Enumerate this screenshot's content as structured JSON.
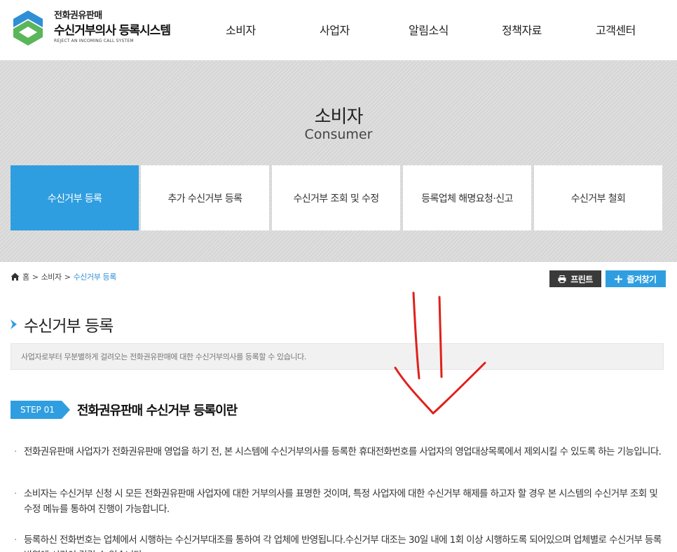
{
  "header": {
    "logo_line1": "전화권유판매",
    "logo_line2": "수신거부의사 등록시스템",
    "logo_line3": "REJECT AN INCOMING CALL SYSTEM",
    "nav": [
      "소비자",
      "사업자",
      "알림소식",
      "정책자료",
      "고객센터"
    ]
  },
  "visual": {
    "title": "소비자",
    "subtitle": "Consumer",
    "tabs": [
      "수신거부 등록",
      "추가 수신거부 등록",
      "수신거부 조회 및 수정",
      "등록업체 해명요청·신고",
      "수신거부 철회"
    ],
    "active_tab": 0
  },
  "breadcrumb": {
    "home": "홈",
    "sep": ">",
    "level1": "소비자",
    "current": "수신거부 등록"
  },
  "buttons": {
    "print": "프린트",
    "favorite": "즐겨찾기"
  },
  "page": {
    "title": "수신거부 등록",
    "description": "사업자로부터 무분별하게 걸려오는 전화권유판매에 대한 수신거부의사를 등록할 수 있습니다.",
    "step_badge": "STEP 01",
    "step_title": "전화권유판매 수신거부 등록이란",
    "bullets": [
      "전화권유판매 사업자가 전화권유판매 영업을 하기 전, 본 시스템에 수신거부의사를 등록한 휴대전화번호를 사업자의 영업대상목록에서 제외시킬 수 있도록 하는 기능입니다.",
      "소비자는 수신거부 신청 시 모든 전화권유판매 사업자에 대한 거부의사를 표명한 것이며, 특정 사업자에 대한 수신거부 해제를 하고자 할 경우 본 시스템의 수신거부 조회 및 수정 메뉴를 통하여 진행이 가능합니다.",
      "등록하신 전화번호는 업체에서 시행하는 수신거부대조를 통하여 각 업체에 반영됩니다.수신거부 대조는 30일 내에 1회 이상 시행하도록 되어있으며 업체별로 수신거부 등록반영에 시간이 걸릴 수 있습니다."
    ]
  },
  "colors": {
    "accent": "#2f9ee0",
    "dark_button": "#3a3a3a",
    "annotation": "#e0201a"
  }
}
